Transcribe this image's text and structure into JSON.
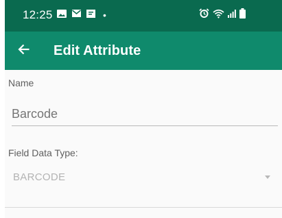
{
  "status_bar": {
    "time": "12:25",
    "left_icons": [
      "image-icon",
      "mail-icon",
      "notification-icon"
    ],
    "dot": "•",
    "right_icons": [
      "alarm-icon",
      "wifi-icon",
      "signal-icon",
      "battery-icon"
    ]
  },
  "app_bar": {
    "title": "Edit Attribute",
    "back_icon": "arrow-left-icon"
  },
  "form": {
    "name_label": "Name",
    "name_placeholder": "Barcode",
    "field_type_label": "Field Data Type:",
    "field_type_value": "BARCODE"
  },
  "colors": {
    "status_bar": "#0a6a4f",
    "app_bar": "#0f8a6c",
    "background": "#fafafa"
  }
}
